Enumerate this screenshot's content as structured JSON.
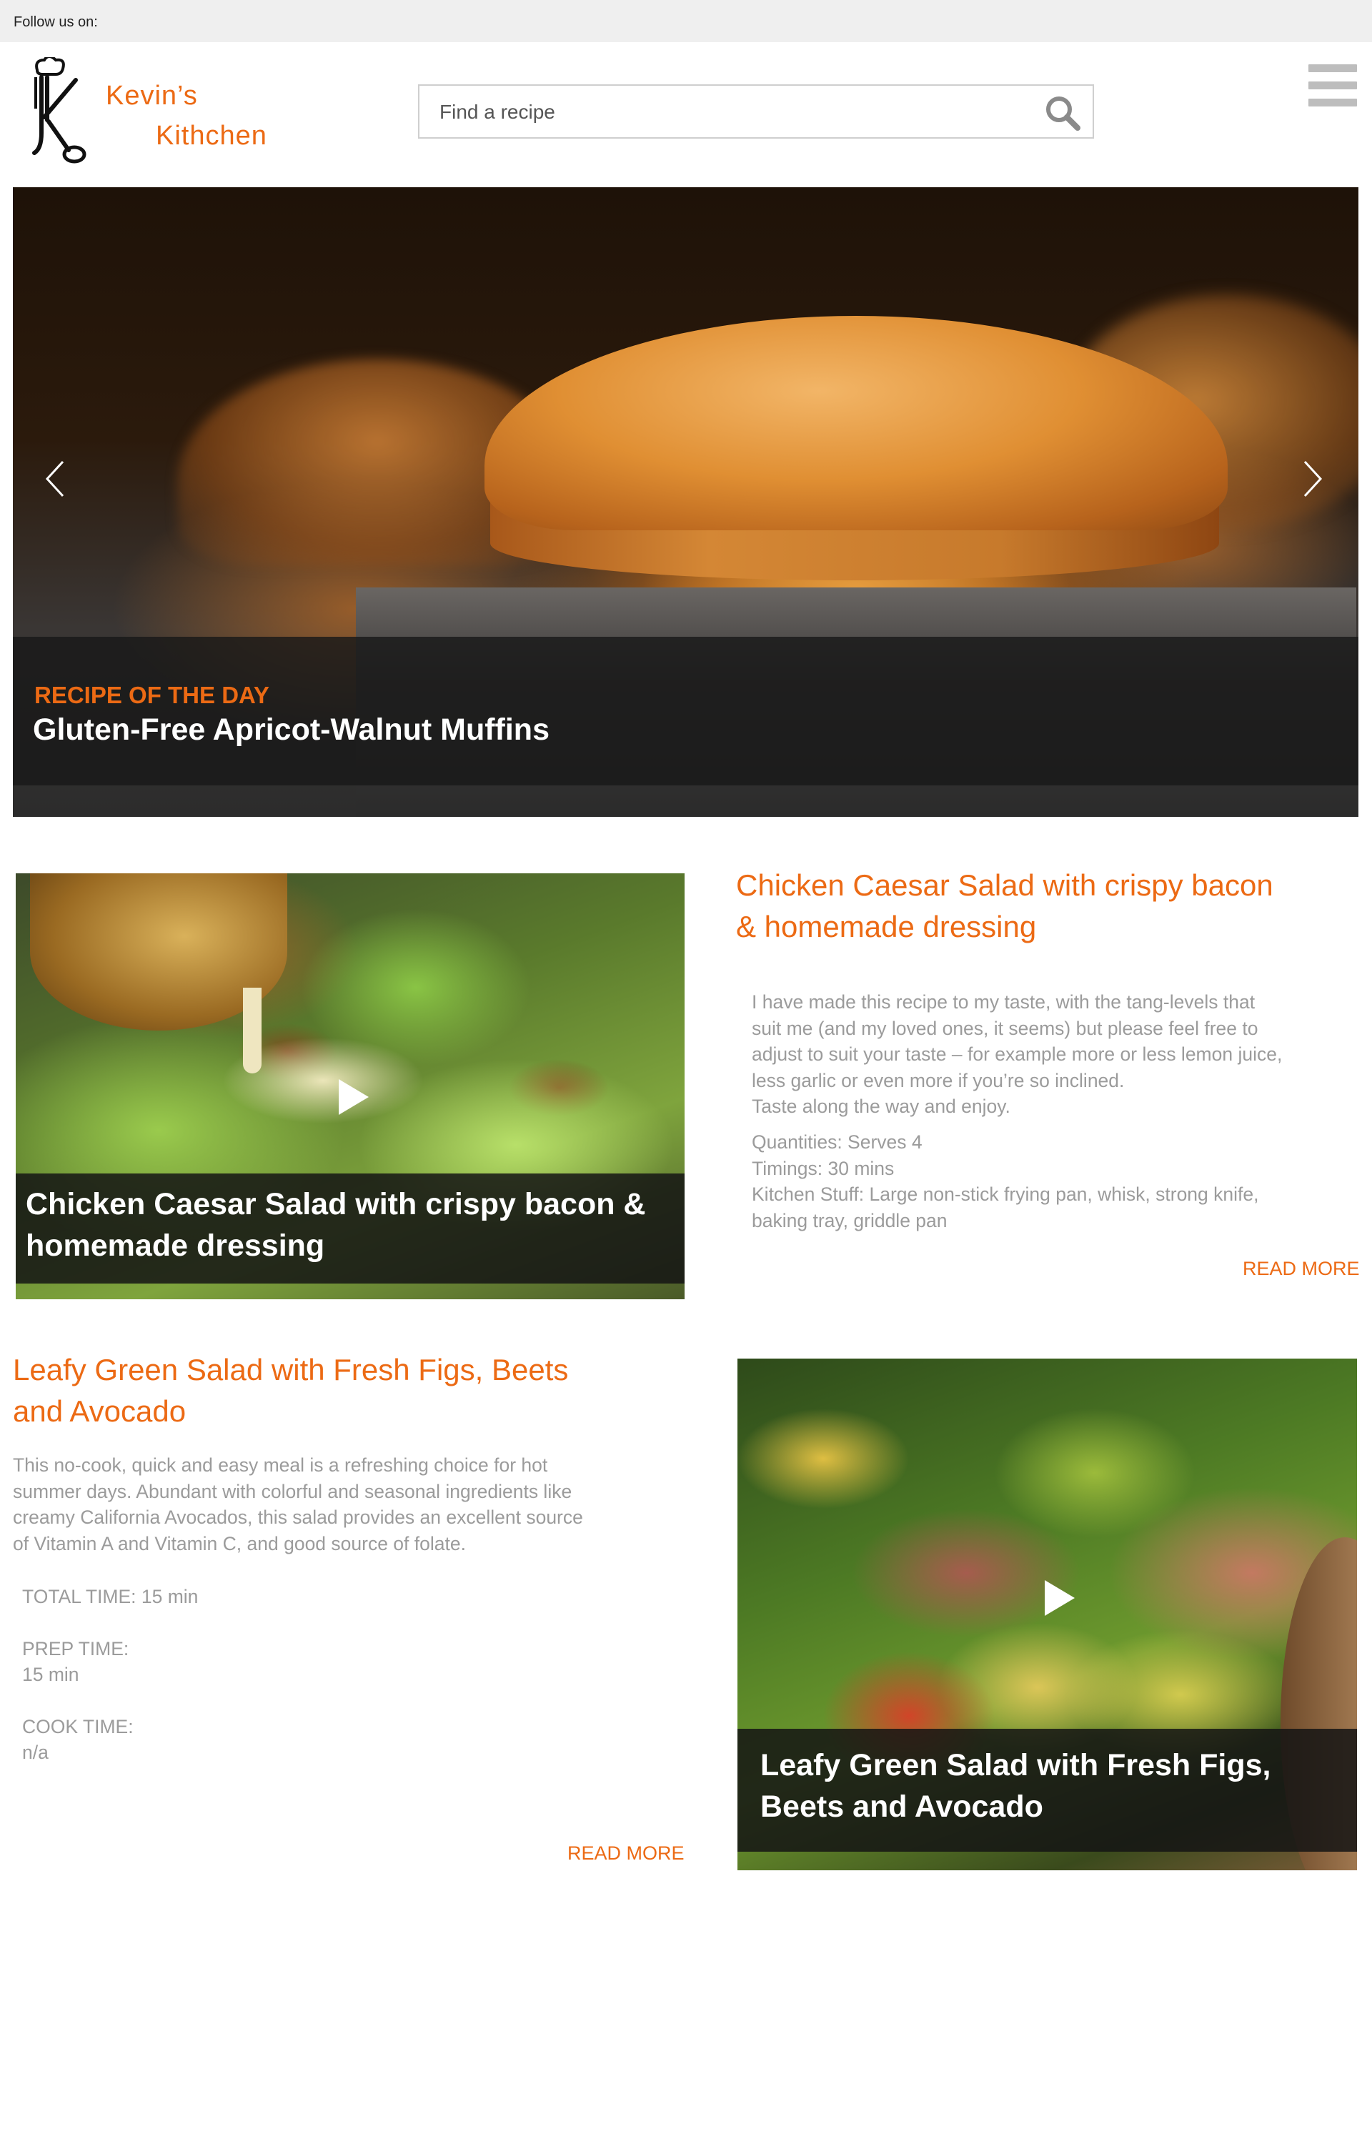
{
  "topbar": {
    "follow_text": "Follow us on:"
  },
  "header": {
    "logo": {
      "line1": "Kevin’s",
      "line2": "Kithchen"
    },
    "search": {
      "placeholder": "Find a recipe"
    },
    "icons": {
      "search": "search-icon",
      "menu": "hamburger-menu-icon",
      "logo": "chef-fork-spoon-logo"
    }
  },
  "colors": {
    "accent": "#ec6a14",
    "text_muted": "#9b9b9b",
    "topbar_bg": "#efefef"
  },
  "hero": {
    "kicker": "RECIPE OF THE DAY",
    "title": "Gluten-Free Apricot-Walnut Muffins",
    "icons": {
      "prev": "chevron-left-icon",
      "next": "chevron-right-icon"
    }
  },
  "recipes": [
    {
      "title": "Chicken Caesar Salad with crispy bacon\n & homemade dressing",
      "image_caption": "Chicken Caesar Salad with crispy bacon &\nhomemade dressing",
      "description": "I have made this recipe to my taste, with the tang-levels that\nsuit me (and my loved ones, it seems) but please feel free to\nadjust to suit your taste – for example more or less lemon juice,\nless garlic or even more if you’re so inclined.\nTaste along the way and enjoy.",
      "quantities": "Quantities: Serves 4",
      "timings": "Timings: 30 mins",
      "kitchen_stuff": "Kitchen Stuff: Large non-stick frying pan, whisk, strong knife,\nbaking tray, griddle pan",
      "read_more": "READ MORE",
      "play_icon": "play-icon"
    },
    {
      "title": "Leafy Green Salad with Fresh Figs, Beets\nand Avocado",
      "image_caption": "Leafy Green Salad with Fresh Figs,\nBeets and Avocado",
      "description": "This no-cook, quick and easy meal is a refreshing choice for hot\nsummer days. Abundant with colorful and seasonal ingredients like\ncreamy California Avocados, this salad provides an excellent source\nof Vitamin A and Vitamin C, and good source of folate.",
      "total_time": "TOTAL TIME: 15 min",
      "prep_time_label": "PREP TIME:",
      "prep_time_value": "15 min",
      "cook_time_label": "COOK TIME:",
      "cook_time_value": "n/a",
      "read_more": "READ MORE",
      "play_icon": "play-icon"
    }
  ]
}
